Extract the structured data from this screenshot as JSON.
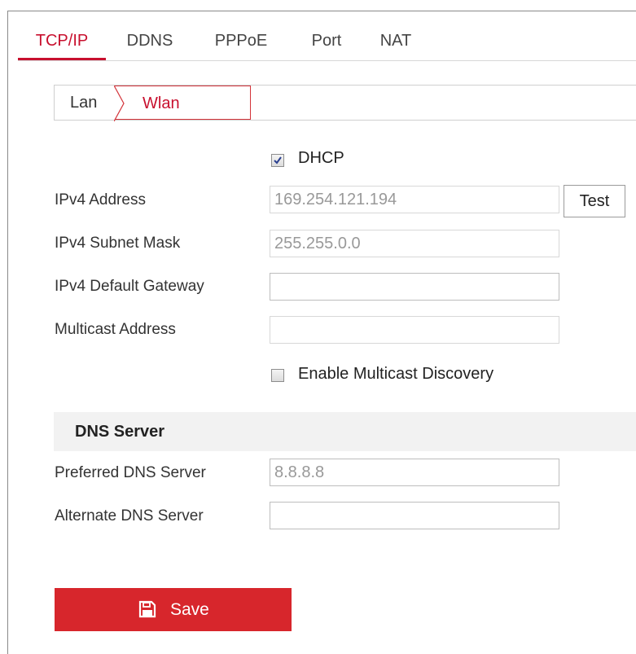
{
  "tabs": [
    {
      "label": "TCP/IP",
      "active": true
    },
    {
      "label": "DDNS",
      "active": false
    },
    {
      "label": "PPPoE",
      "active": false
    },
    {
      "label": "Port",
      "active": false
    },
    {
      "label": "NAT",
      "active": false
    }
  ],
  "subtabs": [
    {
      "label": "Lan",
      "active": false
    },
    {
      "label": "Wlan",
      "active": true
    }
  ],
  "form": {
    "dhcp": {
      "label": "DHCP",
      "checked": true
    },
    "ipv4_address": {
      "label": "IPv4 Address",
      "value": "169.254.121.194"
    },
    "test_label": "Test",
    "ipv4_subnet_mask": {
      "label": "IPv4 Subnet Mask",
      "value": "255.255.0.0"
    },
    "ipv4_default_gateway": {
      "label": "IPv4 Default Gateway",
      "value": ""
    },
    "multicast_address": {
      "label": "Multicast Address",
      "value": ""
    },
    "enable_multicast_discovery": {
      "label": "Enable Multicast Discovery",
      "checked": false
    }
  },
  "dns": {
    "title": "DNS Server",
    "preferred": {
      "label": "Preferred DNS Server",
      "value": "8.8.8.8"
    },
    "alternate": {
      "label": "Alternate DNS Server",
      "value": ""
    }
  },
  "save_label": "Save",
  "colors": {
    "accent": "#c8102e",
    "save_button": "#d7262c",
    "section_header_bg": "#f2f2f2"
  }
}
